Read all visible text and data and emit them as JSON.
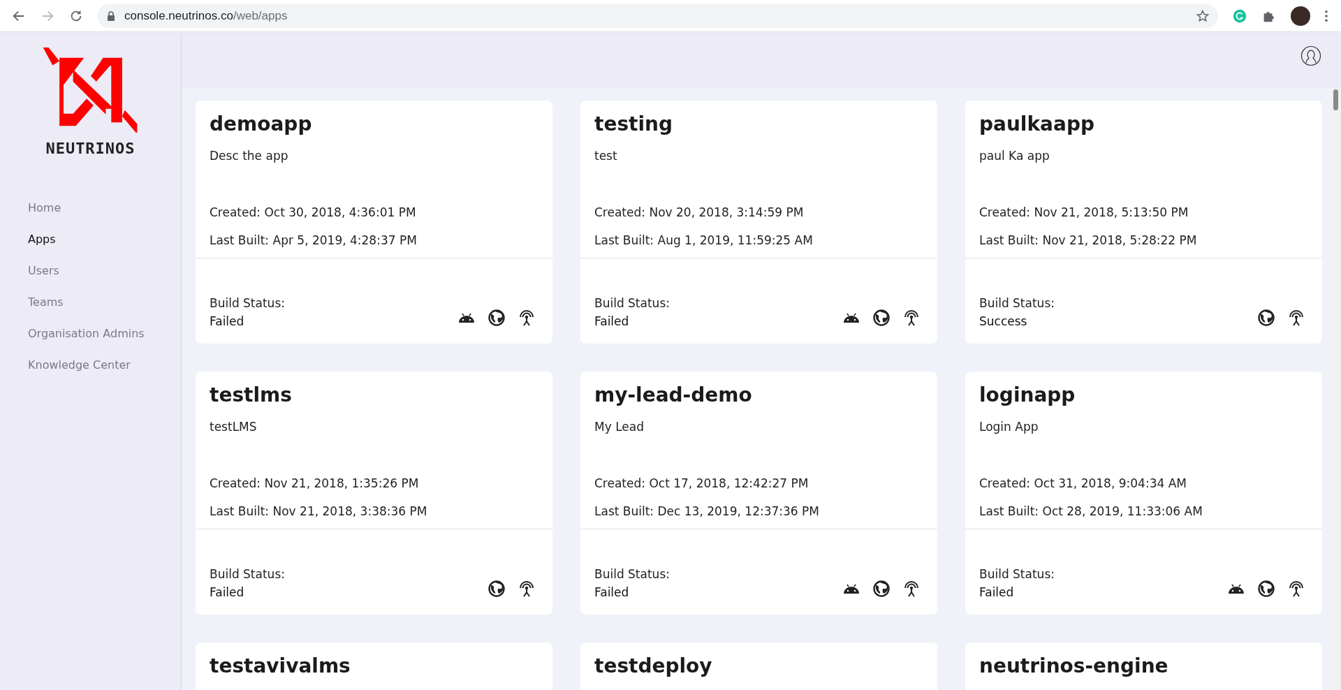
{
  "browser": {
    "url_host": "console.neutrinos.co",
    "url_path": "/web/apps"
  },
  "sidebar": {
    "logo_text": "NEUTRINOS",
    "items": [
      {
        "label": "Home",
        "selected": false
      },
      {
        "label": "Apps",
        "selected": true
      },
      {
        "label": "Users",
        "selected": false
      },
      {
        "label": "Teams",
        "selected": false
      },
      {
        "label": "Organisation Admins",
        "selected": false
      },
      {
        "label": "Knowledge Center",
        "selected": false
      }
    ]
  },
  "apps": [
    {
      "name": "demoapp",
      "description": "Desc the app",
      "created_label": "Created:",
      "created": "Oct 30, 2018, 4:36:01 PM",
      "built_label": "Last Built:",
      "built": "Apr 5, 2019, 4:28:37 PM",
      "status_label": "Build Status:",
      "status": "Failed",
      "platforms": [
        {
          "kind": "android"
        },
        {
          "kind": "web"
        },
        {
          "kind": "antenna"
        }
      ]
    },
    {
      "name": "testing",
      "description": "test",
      "created_label": "Created:",
      "created": "Nov 20, 2018, 3:14:59 PM",
      "built_label": "Last Built:",
      "built": "Aug 1, 2019, 11:59:25 AM",
      "status_label": "Build Status:",
      "status": "Failed",
      "platforms": [
        {
          "kind": "android"
        },
        {
          "kind": "web"
        },
        {
          "kind": "antenna"
        }
      ]
    },
    {
      "name": "paulkaapp",
      "description": "paul Ka app",
      "created_label": "Created:",
      "created": "Nov 21, 2018, 5:13:50 PM",
      "built_label": "Last Built:",
      "built": "Nov 21, 2018, 5:28:22 PM",
      "status_label": "Build Status:",
      "status": "Success",
      "platforms": [
        {
          "kind": "web"
        },
        {
          "kind": "antenna"
        }
      ]
    },
    {
      "name": "testlms",
      "description": "testLMS",
      "created_label": "Created:",
      "created": "Nov 21, 2018, 1:35:26 PM",
      "built_label": "Last Built:",
      "built": "Nov 21, 2018, 3:38:36 PM",
      "status_label": "Build Status:",
      "status": "Failed",
      "platforms": [
        {
          "kind": "web"
        },
        {
          "kind": "antenna"
        }
      ]
    },
    {
      "name": "my-lead-demo",
      "description": "My Lead",
      "created_label": "Created:",
      "created": "Oct 17, 2018, 12:42:27 PM",
      "built_label": "Last Built:",
      "built": "Dec 13, 2019, 12:37:36 PM",
      "status_label": "Build Status:",
      "status": "Failed",
      "platforms": [
        {
          "kind": "android"
        },
        {
          "kind": "web"
        },
        {
          "kind": "antenna"
        }
      ]
    },
    {
      "name": "loginapp",
      "description": "Login App",
      "created_label": "Created:",
      "created": "Oct 31, 2018, 9:04:34 AM",
      "built_label": "Last Built:",
      "built": "Oct 28, 2019, 11:33:06 AM",
      "status_label": "Build Status:",
      "status": "Failed",
      "platforms": [
        {
          "kind": "android"
        },
        {
          "kind": "web"
        },
        {
          "kind": "antenna"
        }
      ]
    },
    {
      "name": "testavivalms"
    },
    {
      "name": "testdeploy"
    },
    {
      "name": "neutrinos-engine"
    }
  ]
}
